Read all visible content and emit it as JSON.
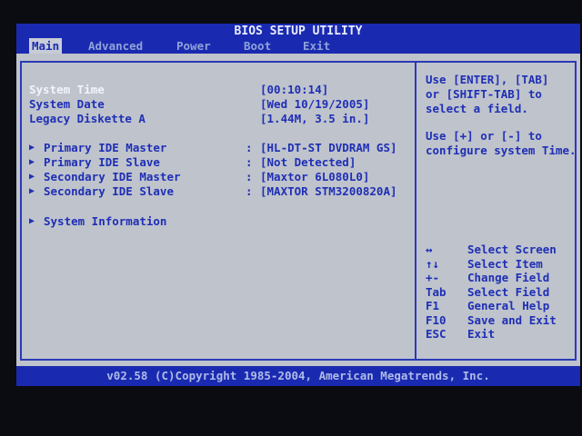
{
  "title": "BIOS SETUP UTILITY",
  "menu": [
    {
      "label": "Main",
      "active": true
    },
    {
      "label": "Advanced",
      "active": false
    },
    {
      "label": "Power",
      "active": false
    },
    {
      "label": "Boot",
      "active": false
    },
    {
      "label": "Exit",
      "active": false
    }
  ],
  "main": {
    "settings": [
      {
        "label": "System Time",
        "value": "[00:10:14]"
      },
      {
        "label": "System Date",
        "value": "[Wed 10/19/2005]"
      },
      {
        "label": "Legacy Diskette A",
        "value": "[1.44M, 3.5 in.]"
      }
    ],
    "ide": [
      {
        "label": "Primary IDE Master",
        "sep": ":",
        "value": "[HL-DT-ST DVDRAM GS]"
      },
      {
        "label": "Primary IDE Slave",
        "sep": ":",
        "value": "[Not Detected]"
      },
      {
        "label": "Secondary IDE Master",
        "sep": ":",
        "value": "[Maxtor 6L080L0]"
      },
      {
        "label": "Secondary IDE Slave",
        "sep": ":",
        "value": "[MAXTOR STM3200820A]"
      }
    ],
    "system_info": {
      "label": "System Information"
    }
  },
  "help": {
    "line1": "Use [ENTER], [TAB]",
    "line2": "or [SHIFT-TAB] to",
    "line3": "select a field.",
    "line4": "Use [+] or [-] to",
    "line5": "configure system Time."
  },
  "keys": [
    {
      "key": "↔",
      "desc": "Select Screen"
    },
    {
      "key": "↑↓",
      "desc": "Select Item"
    },
    {
      "key": "+-",
      "desc": "Change Field"
    },
    {
      "key": "Tab",
      "desc": "Select Field"
    },
    {
      "key": "F1",
      "desc": "General Help"
    },
    {
      "key": "F10",
      "desc": "Save and Exit"
    },
    {
      "key": "ESC",
      "desc": "Exit"
    }
  ],
  "footer": "v02.58 (C)Copyright 1985-2004, American Megatrends, Inc.",
  "colors": {
    "background": "#0b0b12",
    "bar_blue": "#1a2ab0",
    "panel_gray": "#bfc3cc",
    "text_blue": "#1e2fb5",
    "text_white": "#f2f4fa"
  },
  "icons": {
    "submenu_marker": "triangle-right-icon"
  }
}
